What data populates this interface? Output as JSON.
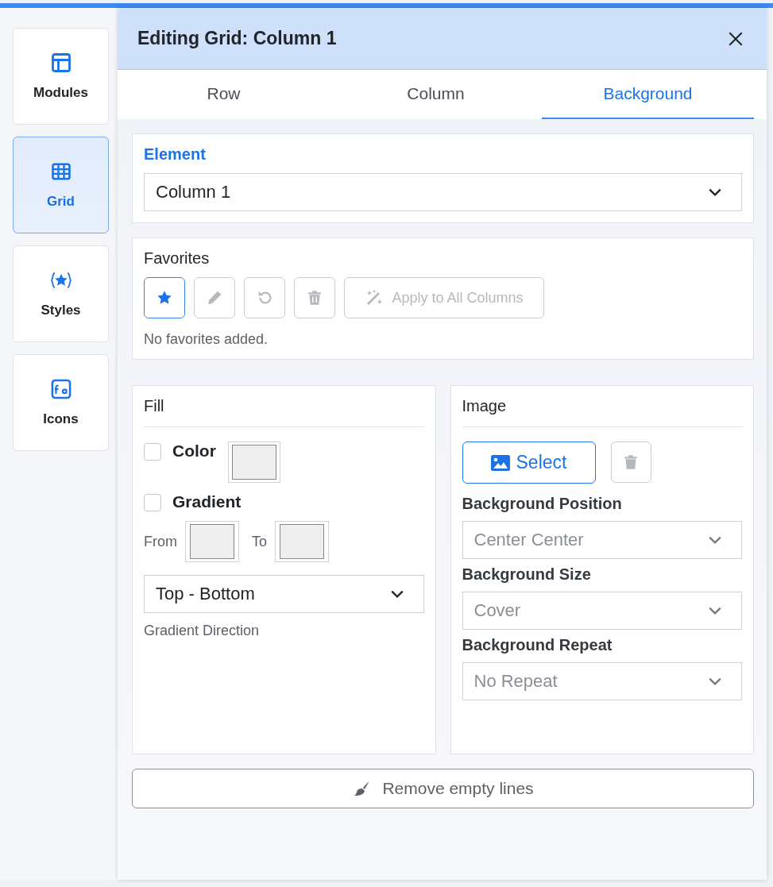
{
  "sidebar": {
    "items": [
      {
        "label": "Modules",
        "selected": false
      },
      {
        "label": "Grid",
        "selected": true
      },
      {
        "label": "Styles",
        "selected": false
      },
      {
        "label": "Icons",
        "selected": false
      }
    ]
  },
  "panel": {
    "title": "Editing Grid: Column 1",
    "tabs": [
      {
        "label": "Row",
        "selected": false
      },
      {
        "label": "Column",
        "selected": false
      },
      {
        "label": "Background",
        "selected": true
      }
    ],
    "element": {
      "label": "Element",
      "value": "Column 1"
    },
    "favorites": {
      "title": "Favorites",
      "buttons": [
        {
          "kind": "star",
          "disabled": false
        },
        {
          "kind": "pencil",
          "disabled": true
        },
        {
          "kind": "undo",
          "disabled": true
        },
        {
          "kind": "trash",
          "disabled": true
        },
        {
          "kind": "apply",
          "label": "Apply to All Columns",
          "disabled": true
        }
      ],
      "empty_text": "No favorites added."
    },
    "fill": {
      "title": "Fill",
      "color": {
        "label": "Color",
        "checked": false
      },
      "gradient": {
        "label": "Gradient",
        "checked": false
      },
      "from_label": "From",
      "to_label": "To",
      "direction": {
        "value": "Top - Bottom",
        "caption": "Gradient Direction"
      }
    },
    "image": {
      "title": "Image",
      "select_label": "Select",
      "delete_disabled": true,
      "fields": [
        {
          "label": "Background Position",
          "value": "Center Center"
        },
        {
          "label": "Background Size",
          "value": "Cover"
        },
        {
          "label": "Background Repeat",
          "value": "No Repeat"
        }
      ]
    },
    "remove_button": "Remove empty lines"
  }
}
